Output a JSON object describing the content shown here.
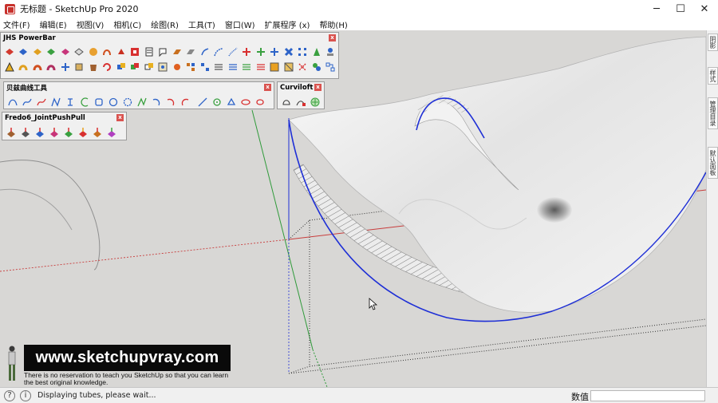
{
  "window": {
    "title": "无标题 - SketchUp Pro 2020",
    "controls": {
      "minimize": "─",
      "maximize": "☐",
      "close": "✕"
    }
  },
  "menu": [
    "文件(F)",
    "编辑(E)",
    "视图(V)",
    "相机(C)",
    "绘图(R)",
    "工具(T)",
    "窗口(W)",
    "扩展程序 (x)",
    "帮助(H)"
  ],
  "toolbars": {
    "powerbar": {
      "title": "JHS PowerBar",
      "close": "x"
    },
    "bezier": {
      "title": "贝兹曲线工具",
      "close": "x"
    },
    "curviloft": {
      "title": "Curviloft",
      "close": "x"
    },
    "fredo": {
      "title": "Fredo6_JointPushPull",
      "close": "x"
    }
  },
  "tray_tabs": [
    "阴影",
    "样式",
    "管理目录",
    "默认面板"
  ],
  "watermark": {
    "url": "www.sketchupvray.com",
    "tagline": "There is no reservation to teach you SketchUp so that you can learn the best original knowledge."
  },
  "status": {
    "message": "Displaying tubes, please wait...",
    "measure_label": "数值",
    "measure_value": ""
  },
  "colors": {
    "viewport": "#d8d7d5",
    "edge_blue": "#1e2fd6",
    "axis_red": "#c83c3c",
    "axis_green": "#2f9a3a"
  }
}
